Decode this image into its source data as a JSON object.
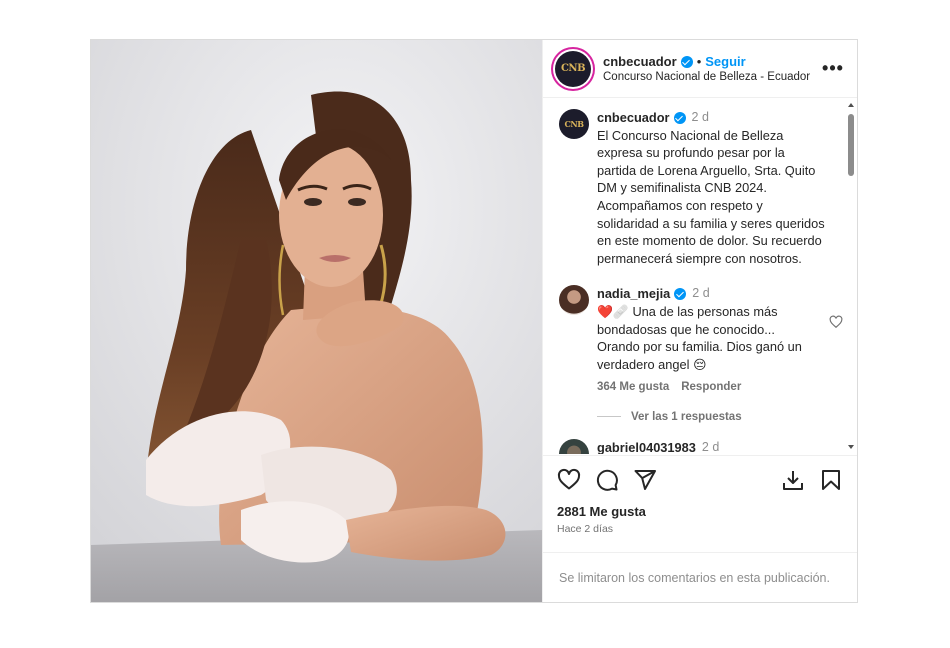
{
  "account": {
    "username": "cnbecuador",
    "avatar_text": "CNB",
    "follow_label": "Seguir",
    "location": "Concurso Nacional de Belleza - Ecuador",
    "more_label": "•••"
  },
  "caption": {
    "username": "cnbecuador",
    "time": "2 d",
    "text": "El Concurso Nacional de Belleza expresa su profundo pesar por la partida de Lorena Arguello, Srta. Quito DM y semifinalista CNB 2024. Acompañamos con respeto y solidaridad a su familia y seres queridos en este momento de dolor. Su recuerdo permanecerá siempre con nosotros."
  },
  "comments": [
    {
      "username": "nadia_mejia",
      "time": "2 d",
      "emoji_prefix": "❤️🩹",
      "text": "Una de las personas más bondadosas que he conocido... Orando por su familia. Dios ganó un verdadero angel",
      "emoji_suffix": "😔",
      "likes": "364 Me gusta",
      "reply_label": "Responder",
      "view_replies": "Ver las 1 respuestas"
    },
    {
      "username": "gabriel04031983",
      "time": "2 d"
    }
  ],
  "actions": {
    "icons": [
      "heart-icon",
      "comment-icon",
      "share-icon",
      "download-icon",
      "bookmark-icon"
    ],
    "likes": "2881 Me gusta",
    "when": "Hace 2 días"
  },
  "comments_limited": "Se limitaron los comentarios en esta publicación."
}
